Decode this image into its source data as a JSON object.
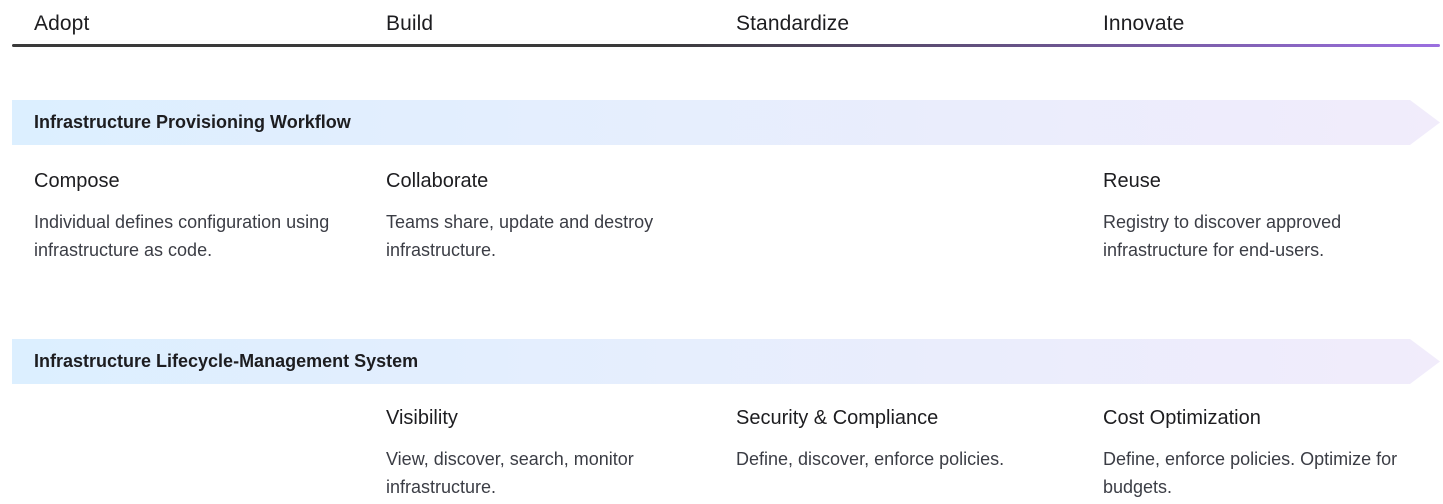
{
  "stages": [
    "Adopt",
    "Build",
    "Standardize",
    "Innovate"
  ],
  "colors": {
    "stage_line_start": "#3a3a3a",
    "stage_line_end": "#9b6fe0",
    "band_start": "#dcefff",
    "band_end": "#f1ecfb"
  },
  "workflow": {
    "title": "Infrastructure Provisioning Workflow",
    "cards": [
      {
        "heading": "Compose",
        "text": "Individual defines configuration using infrastructure as code."
      },
      {
        "heading": "Collaborate",
        "text": "Teams share, update and destroy infrastructure."
      },
      {
        "heading": "Reuse",
        "text": "Registry to discover approved infrastructure for end-users."
      }
    ]
  },
  "lifecycle": {
    "title": "Infrastructure Lifecycle-Management System",
    "cards": [
      {
        "heading": "Visibility",
        "text": "View, discover, search, monitor infrastructure."
      },
      {
        "heading": "Security & Compliance",
        "text": "Define, discover, enforce policies."
      },
      {
        "heading": "Cost Optimization",
        "text": "Define, enforce policies. Optimize for budgets."
      }
    ]
  }
}
